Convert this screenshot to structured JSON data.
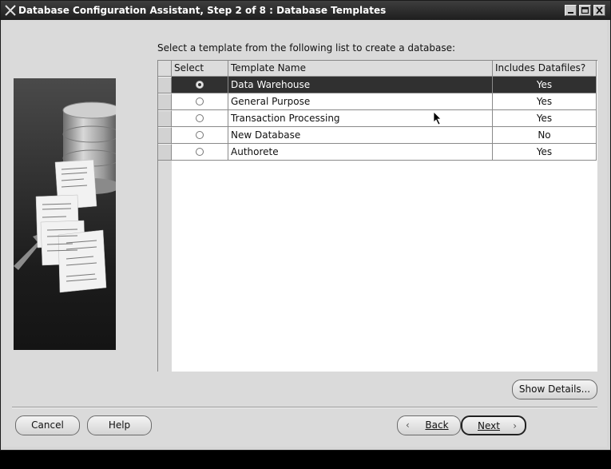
{
  "window": {
    "title": "Database Configuration Assistant, Step 2 of 8 : Database Templates"
  },
  "instruction": "Select a template from the following list to create a database:",
  "table": {
    "columns": [
      "Select",
      "Template Name",
      "Includes Datafiles?"
    ],
    "rows": [
      {
        "name": "Data Warehouse",
        "datafiles": "Yes",
        "selected": true
      },
      {
        "name": "General Purpose",
        "datafiles": "Yes",
        "selected": false
      },
      {
        "name": "Transaction Processing",
        "datafiles": "Yes",
        "selected": false
      },
      {
        "name": "New Database",
        "datafiles": "No",
        "selected": false
      },
      {
        "name": "Authorete",
        "datafiles": "Yes",
        "selected": false
      }
    ]
  },
  "buttons": {
    "show_details": "Show Details...",
    "cancel": "Cancel",
    "help": "Help",
    "back": "Back",
    "next": "Next"
  },
  "colors": {
    "selected_row": "#303030",
    "background": "#dadada"
  }
}
